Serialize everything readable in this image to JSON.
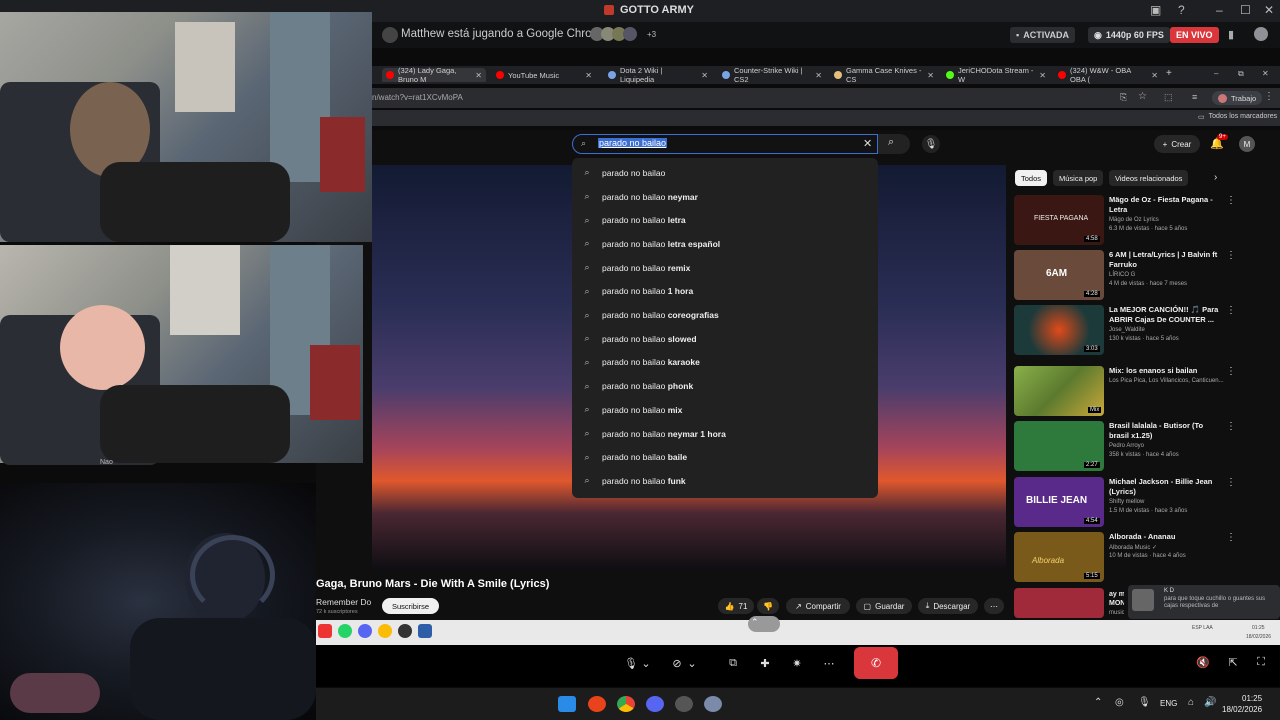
{
  "discord": {
    "window_title": "GOTTO ARMY",
    "activity": "Matthew está jugando a Google Chrome",
    "extra_viewers": "+3",
    "activated": "ACTIVADA",
    "quality": "1440p 60 FPS",
    "live": "EN VIVO",
    "cam_name": "Nao"
  },
  "chrome": {
    "tabs": [
      {
        "label": "(324) Lady Gaga, Bruno M",
        "color": "#ff0000"
      },
      {
        "label": "YouTube Music",
        "color": "#ff0000"
      },
      {
        "label": "Dota 2 Wiki | Liquipedia",
        "color": "#7aa3e5"
      },
      {
        "label": "Counter-Strike Wiki | CS2",
        "color": "#7aa3e5"
      },
      {
        "label": "Gamma Case Knives - CS",
        "color": "#e5c07b"
      },
      {
        "label": "JeriCHODota Stream - W",
        "color": "#53fc18"
      },
      {
        "label": "(324) W&W - OBA OBA (",
        "color": "#ff0000"
      }
    ],
    "new_tab": "+",
    "url": "n/watch?v=rat1XCvMoPA",
    "profile": "Trabajo",
    "bookmarks": "Todos los marcadores"
  },
  "youtube": {
    "search_value": "parado no bailao",
    "suggestions": [
      {
        "prefix": "parado no bailao",
        "suffix": ""
      },
      {
        "prefix": "parado no bailao",
        "suffix": " neymar"
      },
      {
        "prefix": "parado no bailao",
        "suffix": " letra"
      },
      {
        "prefix": "parado no bailao",
        "suffix": " letra español"
      },
      {
        "prefix": "parado no bailao",
        "suffix": " remix"
      },
      {
        "prefix": "parado no bailao",
        "suffix": " 1 hora"
      },
      {
        "prefix": "parado no bailao",
        "suffix": " coreografias"
      },
      {
        "prefix": "parado no bailao",
        "suffix": " slowed"
      },
      {
        "prefix": "parado no bailao",
        "suffix": " karaoke"
      },
      {
        "prefix": "parado no bailao",
        "suffix": " phonk"
      },
      {
        "prefix": "parado no bailao",
        "suffix": " mix"
      },
      {
        "prefix": "parado no bailao",
        "suffix": " neymar 1 hora"
      },
      {
        "prefix": "parado no bailao",
        "suffix": " baile"
      },
      {
        "prefix": "parado no bailao",
        "suffix": " funk"
      }
    ],
    "create_label": "Crear",
    "notif_count": "9+",
    "account_initial": "M",
    "chips": [
      "Todos",
      "Música pop",
      "Videos relacionados"
    ],
    "video_title": "Gaga, Bruno Mars - Die With A Smile (Lyrics)",
    "channel": "Remember Do",
    "subscribers": "72 k suscriptores",
    "subscribe": "Suscribirse",
    "likes": "71",
    "share": "Compartir",
    "save": "Guardar",
    "download": "Descargar",
    "sidebar": [
      {
        "title": "Mägo de Oz - Fiesta Pagana - Letra",
        "channel": "Mägo de Oz Lyrics",
        "views": "6.3 M de vistas · hace 5 años",
        "duration": "4:58",
        "thumb": "#3a1712",
        "thumb_text": "FIESTA PAGANA"
      },
      {
        "title": "6 AM | Letra/Lyrics | J Balvin ft Farruko",
        "channel": "LÍRICO G",
        "views": "4 M de vistas · hace 7 meses",
        "duration": "4:28",
        "thumb": "#6a4a3a",
        "thumb_text": "6AM"
      },
      {
        "title": "La MEJOR CANCIÓN!! 🎵 Para ABRIR Cajas De COUNTER ...",
        "channel": "Jose_Waldite",
        "views": "130 k vistas · hace 5 años",
        "duration": "3:03",
        "thumb": "#1c3a3a",
        "thumb_text": ""
      },
      {
        "title": "Mix: los enanos si bailan",
        "channel": "Los Pica Pica, Los Villancicos, Canticuen...",
        "views": "",
        "duration": "Mix",
        "thumb": "#5c7a2e",
        "thumb_text": ""
      },
      {
        "title": "Brasil lalalala - Butisor (To brasil x1.25)",
        "channel": "Pedro Arroyo",
        "views": "358 k vistas · hace 4 años",
        "duration": "2:27",
        "thumb": "#2d7a3c",
        "thumb_text": ""
      },
      {
        "title": "Michael Jackson - Billie Jean (Lyrics)",
        "channel": "Shifty mellow",
        "views": "1.5 M de vistas · hace 3 años",
        "duration": "4:54",
        "thumb": "#5a2a8a",
        "thumb_text": "BILLIE JEAN"
      },
      {
        "title": "Alborada - Ananau",
        "channel": "Alborada Music ✓",
        "views": "10 M de vistas · hace 4 años",
        "duration": "5:15",
        "thumb": "#7a5a1a",
        "thumb_text": "Alborada"
      },
      {
        "title": "ay mi MON",
        "channel": "music",
        "views": "",
        "duration": "",
        "thumb": "#a02a3a",
        "thumb_text": ""
      }
    ]
  },
  "notification": {
    "user": "K D",
    "text": "para que toque cuchillo o guantes sus cajas respectivas de"
  },
  "tray": {
    "lang": "ESP LAA",
    "lang2": "ENG",
    "time": "01:25",
    "date": "18/02/2026",
    "time_small": "01:25",
    "date_small": "18/02/2026"
  }
}
